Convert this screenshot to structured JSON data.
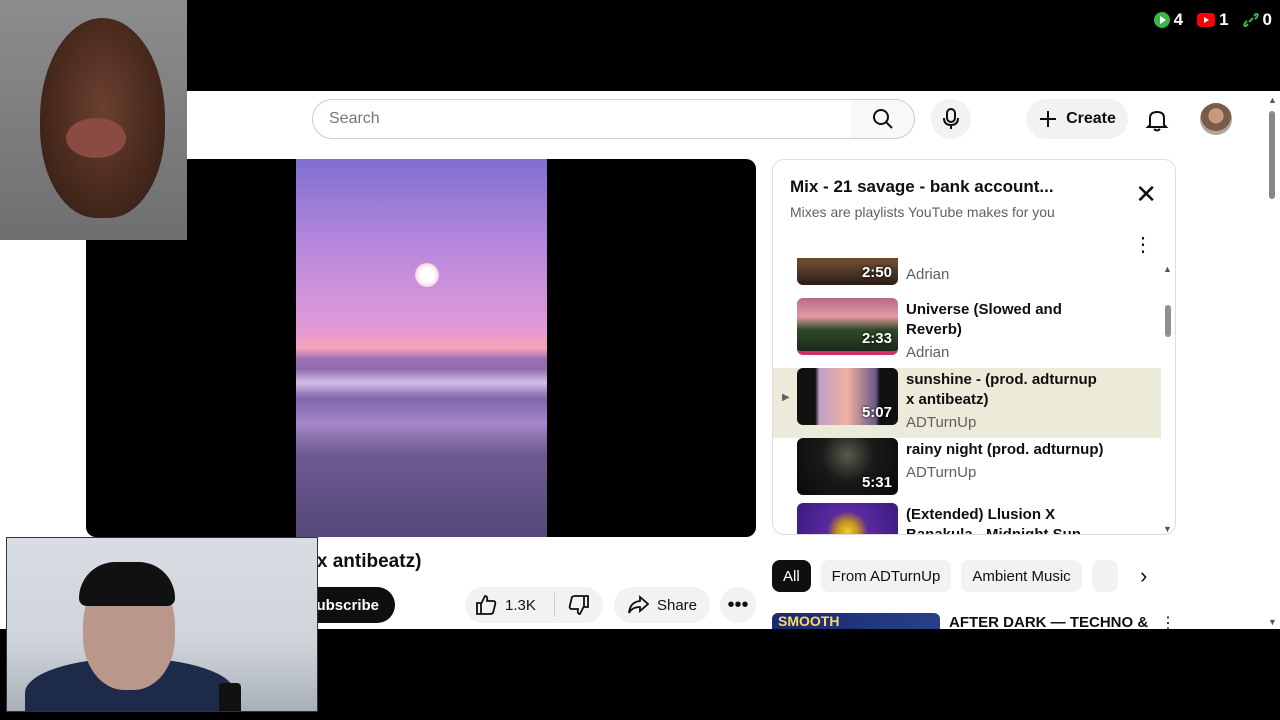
{
  "overlay": {
    "stats": [
      {
        "icon": "play-icon",
        "value": "4",
        "color": "#3bb54a"
      },
      {
        "icon": "youtube-icon",
        "value": "1",
        "color": "#ff0000"
      },
      {
        "icon": "link-icon",
        "value": "0",
        "color": "#3bb54a"
      }
    ]
  },
  "header": {
    "search_placeholder": "Search",
    "create_label": "Create"
  },
  "video": {
    "title_fragment": "p x antibeatz)",
    "subscribe_label": "ubscribe",
    "likes": "1.3K",
    "share_label": "Share"
  },
  "playlist": {
    "title": "Mix - 21 savage - bank account...",
    "subtitle": "Mixes are playlists YouTube makes for you",
    "items": [
      {
        "title": "",
        "channel": "Adrian",
        "duration": "2:50"
      },
      {
        "title": "Universe (Slowed and Reverb)",
        "channel": "Adrian",
        "duration": "2:33"
      },
      {
        "title": "sunshine - (prod. adturnup x antibeatz)",
        "channel": "ADTurnUp",
        "duration": "5:07",
        "active": true
      },
      {
        "title": "rainy night (prod. adturnup)",
        "channel": "ADTurnUp",
        "duration": "5:31"
      },
      {
        "title": "(Extended) Llusion X Banakula - Midnight Sun...",
        "channel": "",
        "duration": ""
      }
    ]
  },
  "chips": [
    "All",
    "From ADTurnUp",
    "Ambient Music"
  ],
  "recommendation": {
    "thumb_text": "SMOOTH",
    "title": "AFTER DARK — TECHNO &"
  }
}
